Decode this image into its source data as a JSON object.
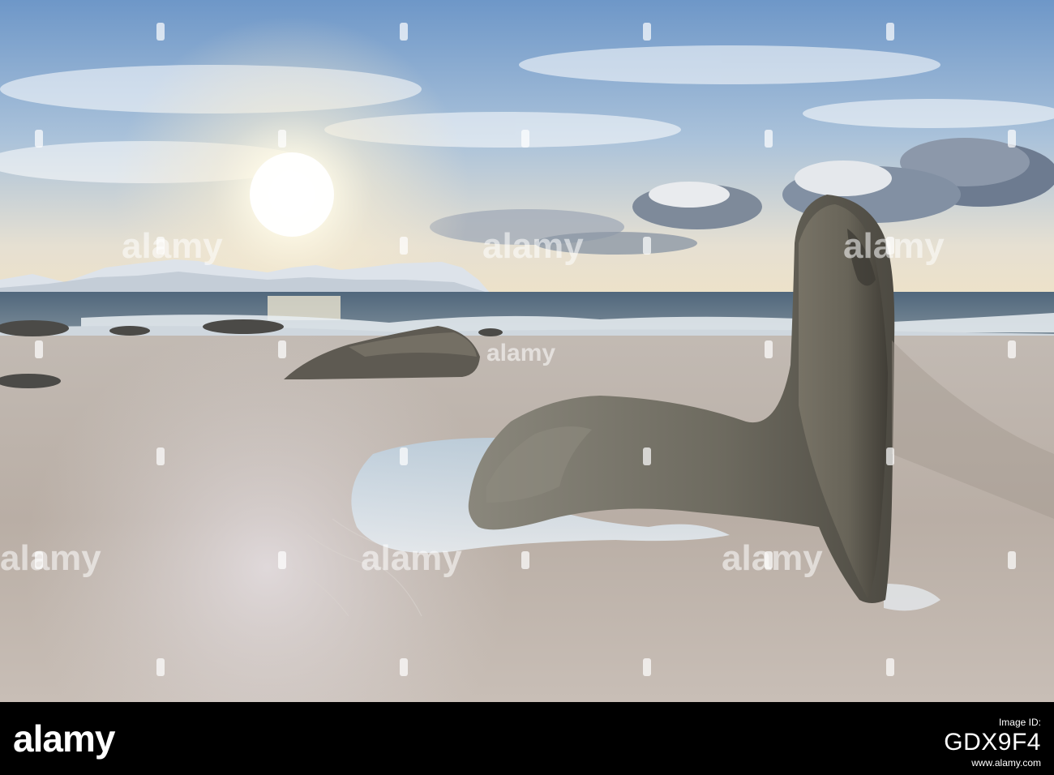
{
  "watermark": {
    "text": "alamy"
  },
  "footer": {
    "brand": "alamy",
    "image_id_label": "Image ID:",
    "image_id": "GDX9F4",
    "url": "www.alamy.com"
  },
  "colors": {
    "sky_top": "#6f98c9",
    "sky_mid": "#c9d6e2",
    "sun_glow": "#fff6d8",
    "sea": "#5f7385",
    "sand": "#c6bdb5",
    "rock": "#6e6b60",
    "footer_bg": "#000000"
  },
  "icons": {
    "watermark_mark": "alamy-logo-icon"
  }
}
